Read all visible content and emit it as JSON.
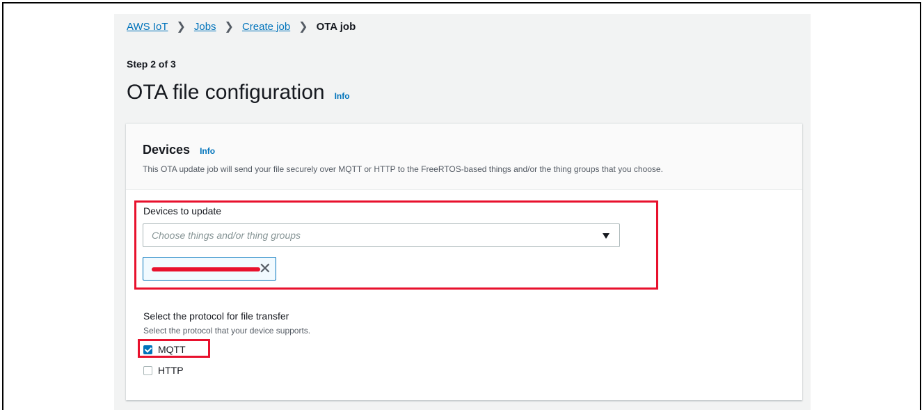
{
  "breadcrumb": {
    "item1": "AWS IoT",
    "item2": "Jobs",
    "item3": "Create job",
    "current": "OTA job"
  },
  "page": {
    "step": "Step 2 of 3",
    "title": "OTA file configuration",
    "info": "Info"
  },
  "devices": {
    "title": "Devices",
    "info": "Info",
    "description": "This OTA update job will send your file securely over MQTT or HTTP to the FreeRTOS-based things and/or the thing groups that you choose.",
    "field_label": "Devices to update",
    "select_placeholder": "Choose things and/or thing groups",
    "token_close_glyph": "✕"
  },
  "protocol": {
    "label": "Select the protocol for file transfer",
    "description": "Select the protocol that your device supports.",
    "options": [
      {
        "label": "MQTT",
        "checked": true
      },
      {
        "label": "HTTP",
        "checked": false
      }
    ]
  },
  "colors": {
    "link": "#0073bb",
    "highlight": "#e8112d",
    "background": "#f2f3f3"
  }
}
